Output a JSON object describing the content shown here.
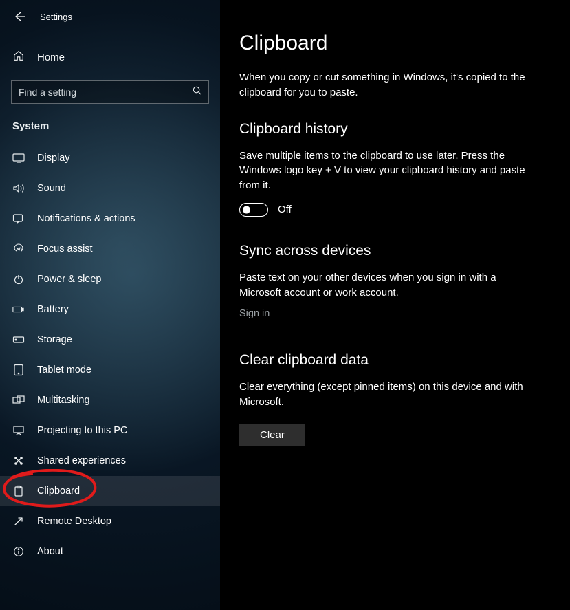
{
  "titlebar": {
    "app_title": "Settings"
  },
  "sidebar": {
    "home_label": "Home",
    "search_placeholder": "Find a setting",
    "section_label": "System",
    "items": [
      {
        "label": "Display"
      },
      {
        "label": "Sound"
      },
      {
        "label": "Notifications & actions"
      },
      {
        "label": "Focus assist"
      },
      {
        "label": "Power & sleep"
      },
      {
        "label": "Battery"
      },
      {
        "label": "Storage"
      },
      {
        "label": "Tablet mode"
      },
      {
        "label": "Multitasking"
      },
      {
        "label": "Projecting to this PC"
      },
      {
        "label": "Shared experiences"
      },
      {
        "label": "Clipboard"
      },
      {
        "label": "Remote Desktop"
      },
      {
        "label": "About"
      }
    ],
    "selected_index": 11
  },
  "main": {
    "title": "Clipboard",
    "intro": "When you copy or cut something in Windows, it's copied to the clipboard for you to paste.",
    "history": {
      "heading": "Clipboard history",
      "desc": "Save multiple items to the clipboard to use later. Press the Windows logo key + V to view your clipboard history and paste from it.",
      "toggle_state": "Off"
    },
    "sync": {
      "heading": "Sync across devices",
      "desc": "Paste text on your other devices when you sign in with a Microsoft account or work account.",
      "link_label": "Sign in"
    },
    "clear": {
      "heading": "Clear clipboard data",
      "desc": "Clear everything (except pinned items) on this device and with Microsoft.",
      "button_label": "Clear"
    }
  },
  "annotation": {
    "circled_item": "Clipboard",
    "color": "#e01b1b"
  }
}
